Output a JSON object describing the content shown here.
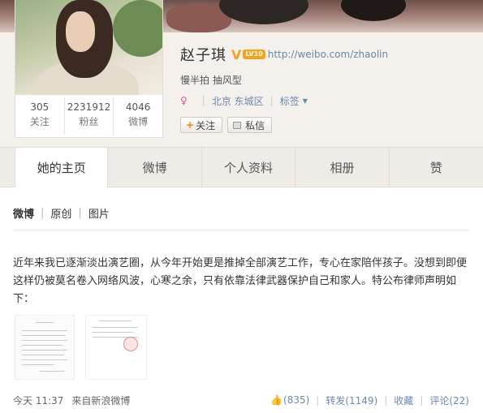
{
  "profile": {
    "name": "赵子琪",
    "verified_mark": "V",
    "level": "LV10",
    "url": "http://weibo.com/zhaolin",
    "bio": "慢半拍 抽风型",
    "location": "北京 东城区",
    "tags_label": "标签",
    "gender_icon": "female-icon",
    "follow_label": "关注",
    "message_label": "私信",
    "stats": [
      {
        "value": "305",
        "label": "关注"
      },
      {
        "value": "2231912",
        "label": "粉丝"
      },
      {
        "value": "4046",
        "label": "微博"
      }
    ]
  },
  "tabs": [
    {
      "label": "她的主页",
      "active": true
    },
    {
      "label": "微博",
      "active": false
    },
    {
      "label": "个人资料",
      "active": false
    },
    {
      "label": "相册",
      "active": false
    },
    {
      "label": "赞",
      "active": false
    }
  ],
  "subnav": {
    "items": [
      "微博",
      "原创",
      "图片"
    ]
  },
  "post": {
    "text": "近年来我已逐渐淡出演艺圈，从今年开始更是推掉全部演艺工作，专心在家陪伴孩子。没想到即便这样仍被莫名卷入网络风波，心寒之余，只有依靠法律武器保护自己和家人。特公布律师声明如下：",
    "time": "今天 11:37",
    "source": "来自新浪微博",
    "like_count": "(835)",
    "repost_label": "转发(1149)",
    "favorite_label": "收藏",
    "comment_label": "评论(22)"
  },
  "colors": {
    "link": "#6b87b0",
    "verified": "#f3a21b",
    "female": "#e44d8f"
  }
}
